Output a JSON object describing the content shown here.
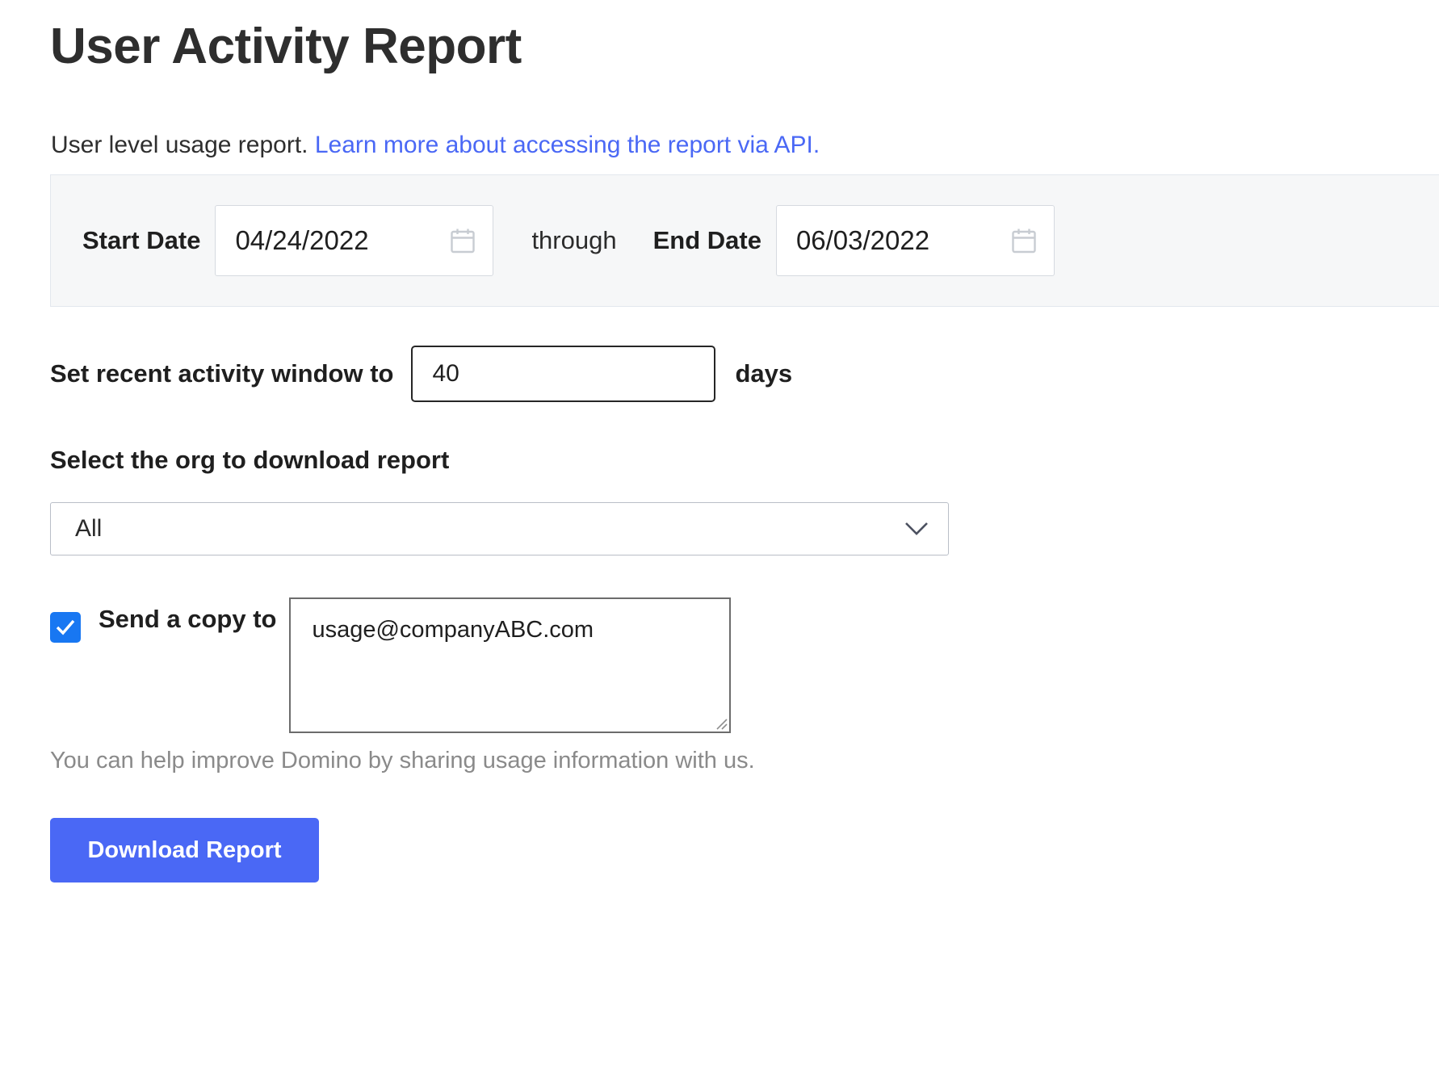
{
  "page": {
    "title": "User Activity Report",
    "subtitle_text": "User level usage report.",
    "subtitle_link": "Learn more about accessing the report via API."
  },
  "date_panel": {
    "start_label": "Start Date",
    "start_value": "04/24/2022",
    "through_label": "through",
    "end_label": "End Date",
    "end_value": "06/03/2022",
    "start_icon": "calendar-icon",
    "end_icon": "calendar-icon"
  },
  "activity_window": {
    "label": "Set recent activity window to",
    "value": "40",
    "unit_label": "days"
  },
  "org_select": {
    "label": "Select the org to download report",
    "selected": "All",
    "chevron_icon": "chevron-down-icon"
  },
  "send_copy": {
    "checked": true,
    "label": "Send a copy to",
    "email_value": "usage@companyABC.com"
  },
  "helper": {
    "text": "You can help improve Domino by sharing usage information with us."
  },
  "actions": {
    "download_label": "Download Report"
  },
  "colors": {
    "accent_blue": "#4a68f5",
    "checkbox_blue": "#1877f2",
    "panel_bg": "#f6f7f8",
    "helper_gray": "#8a8a8a"
  }
}
